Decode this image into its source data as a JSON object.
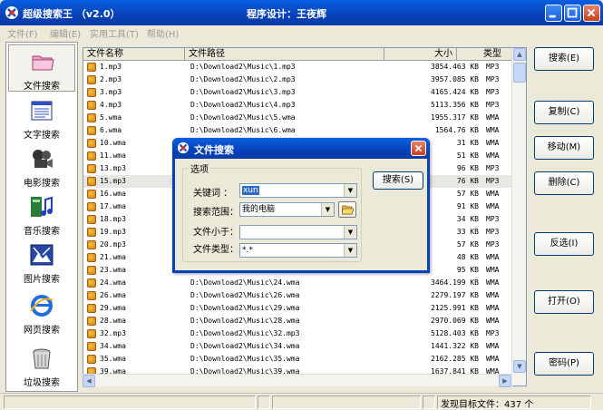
{
  "window": {
    "title": "超级搜索王 （v2.0）",
    "designer": "程序设计：王夜辉"
  },
  "menu": [
    "文件(F)",
    "编辑(E)",
    "实用工具(T)",
    "帮助(H)"
  ],
  "sidebar": [
    {
      "label": "文件搜索",
      "icon": "folder-icon",
      "active": true
    },
    {
      "label": "文字搜索",
      "icon": "document-icon",
      "active": false
    },
    {
      "label": "电影搜索",
      "icon": "film-icon",
      "active": false
    },
    {
      "label": "音乐搜索",
      "icon": "music-icon",
      "active": false
    },
    {
      "label": "图片搜索",
      "icon": "picture-icon",
      "active": false
    },
    {
      "label": "网页搜索",
      "icon": "ie-icon",
      "active": false
    },
    {
      "label": "垃圾搜索",
      "icon": "trash-icon",
      "active": false
    }
  ],
  "table": {
    "columns": [
      "文件名称",
      "文件路径",
      "大小",
      "类型"
    ],
    "rows": [
      {
        "name": "1.mp3",
        "path": "D:\\Download2\\Music\\1.mp3",
        "size": "3854.463 KB",
        "type": "MP3"
      },
      {
        "name": "2.mp3",
        "path": "D:\\Download2\\Music\\2.mp3",
        "size": "3957.085 KB",
        "type": "MP3"
      },
      {
        "name": "3.mp3",
        "path": "D:\\Download2\\Music\\3.mp3",
        "size": "4165.424 KB",
        "type": "MP3"
      },
      {
        "name": "4.mp3",
        "path": "D:\\Download2\\Music\\4.mp3",
        "size": "5113.356 KB",
        "type": "MP3"
      },
      {
        "name": "5.wma",
        "path": "D:\\Download2\\Music\\5.wma",
        "size": "1955.317 KB",
        "type": "WMA"
      },
      {
        "name": "6.wma",
        "path": "D:\\Download2\\Music\\6.wma",
        "size": "1564.76 KB",
        "type": "WMA"
      },
      {
        "name": "10.wma",
        "path": "",
        "size": "31 KB",
        "type": "WMA"
      },
      {
        "name": "11.wma",
        "path": "",
        "size": "51 KB",
        "type": "WMA"
      },
      {
        "name": "13.mp3",
        "path": "",
        "size": "96 KB",
        "type": "MP3"
      },
      {
        "name": "15.mp3",
        "path": "",
        "size": "76 KB",
        "type": "MP3",
        "selected": true
      },
      {
        "name": "16.wma",
        "path": "",
        "size": "57 KB",
        "type": "WMA"
      },
      {
        "name": "17.wma",
        "path": "",
        "size": "91 KB",
        "type": "WMA"
      },
      {
        "name": "18.mp3",
        "path": "",
        "size": "34 KB",
        "type": "MP3"
      },
      {
        "name": "19.mp3",
        "path": "",
        "size": "33 KB",
        "type": "MP3"
      },
      {
        "name": "20.mp3",
        "path": "",
        "size": "57 KB",
        "type": "MP3"
      },
      {
        "name": "21.wma",
        "path": "",
        "size": "48 KB",
        "type": "WMA"
      },
      {
        "name": "23.wma",
        "path": "",
        "size": "95 KB",
        "type": "WMA"
      },
      {
        "name": "24.wma",
        "path": "D:\\Download2\\Music\\24.wma",
        "size": "3464.199 KB",
        "type": "WMA"
      },
      {
        "name": "26.wma",
        "path": "D:\\Download2\\Music\\26.wma",
        "size": "2279.197 KB",
        "type": "WMA"
      },
      {
        "name": "29.wma",
        "path": "D:\\Download2\\Music\\29.wma",
        "size": "2125.991 KB",
        "type": "WMA"
      },
      {
        "name": "28.wma",
        "path": "D:\\Download2\\Music\\28.wma",
        "size": "2970.069 KB",
        "type": "WMA"
      },
      {
        "name": "32.mp3",
        "path": "D:\\Download2\\Music\\32.mp3",
        "size": "5128.403 KB",
        "type": "MP3"
      },
      {
        "name": "34.wma",
        "path": "D:\\Download2\\Music\\34.wma",
        "size": "1441.322 KB",
        "type": "WMA"
      },
      {
        "name": "35.wma",
        "path": "D:\\Download2\\Music\\35.wma",
        "size": "2162.285 KB",
        "type": "WMA"
      },
      {
        "name": "39.wma",
        "path": "D:\\Download2\\Music\\39.wma",
        "size": "1637.841 KB",
        "type": "WMA"
      }
    ]
  },
  "buttons": {
    "search": "搜索(E)",
    "copy": "复制(C)",
    "move": "移动(M)",
    "delete": "删除(C)",
    "invert": "反选(I)",
    "open": "打开(O)",
    "password": "密码(P)"
  },
  "status": {
    "found": "发现目标文件：437 个"
  },
  "dialog": {
    "title": "文件搜索",
    "group_label": "选项",
    "keyword_label": "关键词 ：",
    "keyword_value": "xun",
    "scope_label": "搜索范围：",
    "scope_value": "我的电脑",
    "size_label": "文件小于：",
    "size_value": "",
    "type_label": "文件类型：",
    "type_value": "*.*",
    "search_button": "搜索(S)"
  }
}
